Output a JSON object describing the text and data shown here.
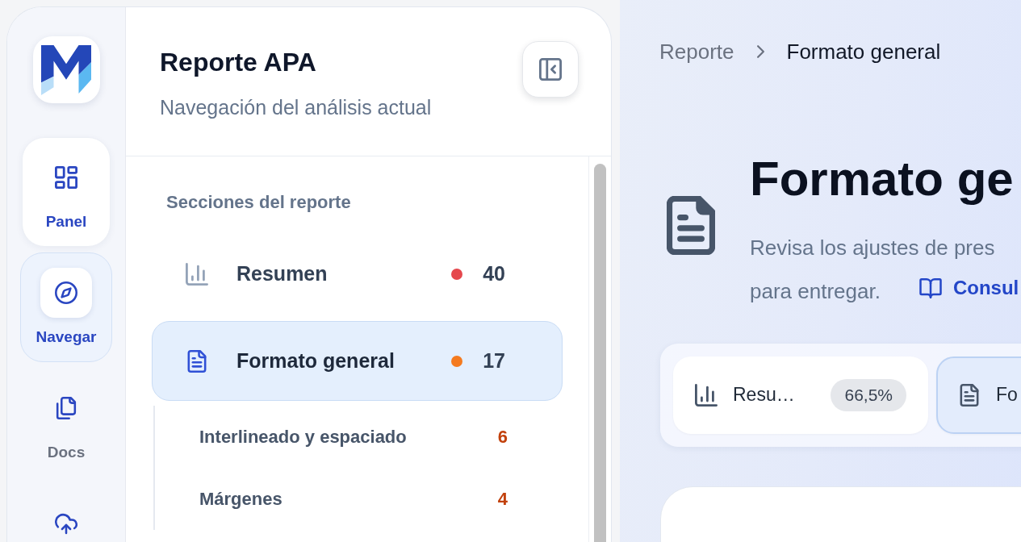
{
  "rail": {
    "items": [
      {
        "label": "Panel",
        "selected": false,
        "highlighted": true
      },
      {
        "label": "Navegar",
        "selected": true,
        "highlighted": false
      },
      {
        "label": "Docs",
        "selected": false,
        "highlighted": false
      },
      {
        "selected": false
      }
    ]
  },
  "sidebar": {
    "title": "Reporte APA",
    "subtitle": "Navegación del análisis actual",
    "section_label": "Secciones del reporte",
    "items": [
      {
        "label": "Resumen",
        "color": "#e5484d",
        "count": "40",
        "selected": false
      },
      {
        "label": "Formato general",
        "color": "#f47a1f",
        "count": "17",
        "selected": true,
        "children": [
          {
            "label": "Interlineado y espaciado",
            "count": "6",
            "selected": false
          },
          {
            "label": "Márgenes",
            "count": "4",
            "selected": false
          }
        ]
      }
    ]
  },
  "breadcrumb": [
    "Reporte",
    "Formato general"
  ],
  "page": {
    "title": "Formato ge",
    "description_lines": [
      "Revisa los ajustes de pres",
      "para entregar."
    ],
    "link": "Consul"
  },
  "section_chips": [
    {
      "label": "Resu…",
      "badge": "66,5%",
      "selected": false
    },
    {
      "label": "Fo",
      "selected": true
    }
  ]
}
